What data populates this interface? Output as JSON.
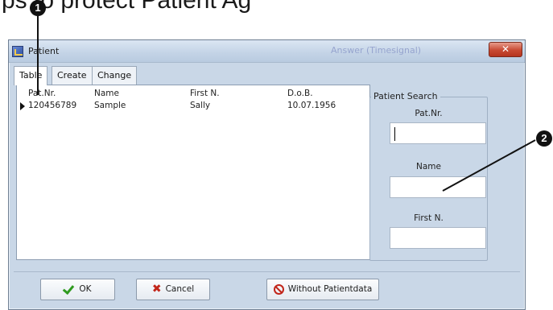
{
  "background_heading": "ps to protect Patient Ag",
  "callouts": [
    "1",
    "2"
  ],
  "window": {
    "title": "Patient",
    "ghost_title": "Answer (Timesignal)",
    "close_symbol": "✕"
  },
  "tabs": [
    {
      "label": "Table",
      "active": true
    },
    {
      "label": "Create",
      "active": false
    },
    {
      "label": "Change",
      "active": false
    }
  ],
  "grid": {
    "columns": [
      "Pat.Nr.",
      "Name",
      "First N.",
      "D.o.B."
    ],
    "rows": [
      [
        "120456789",
        "Sample",
        "Sally",
        "10.07.1956"
      ]
    ]
  },
  "patient_search": {
    "title": "Patient Search",
    "fields": [
      {
        "label": "Pat.Nr.",
        "value": ""
      },
      {
        "label": "Name",
        "value": ""
      },
      {
        "label": "First N.",
        "value": ""
      }
    ]
  },
  "buttons": {
    "ok": "OK",
    "cancel": "Cancel",
    "without": "Without Patientdata"
  },
  "icons": {
    "ok": "check-icon",
    "cancel": "x-icon",
    "without": "no-entry-icon"
  },
  "colors": {
    "window_bg": "#c9d7e7",
    "close_button": "#c84a33",
    "ok_check": "#2f9a1f",
    "cancel_x": "#c2261a"
  }
}
